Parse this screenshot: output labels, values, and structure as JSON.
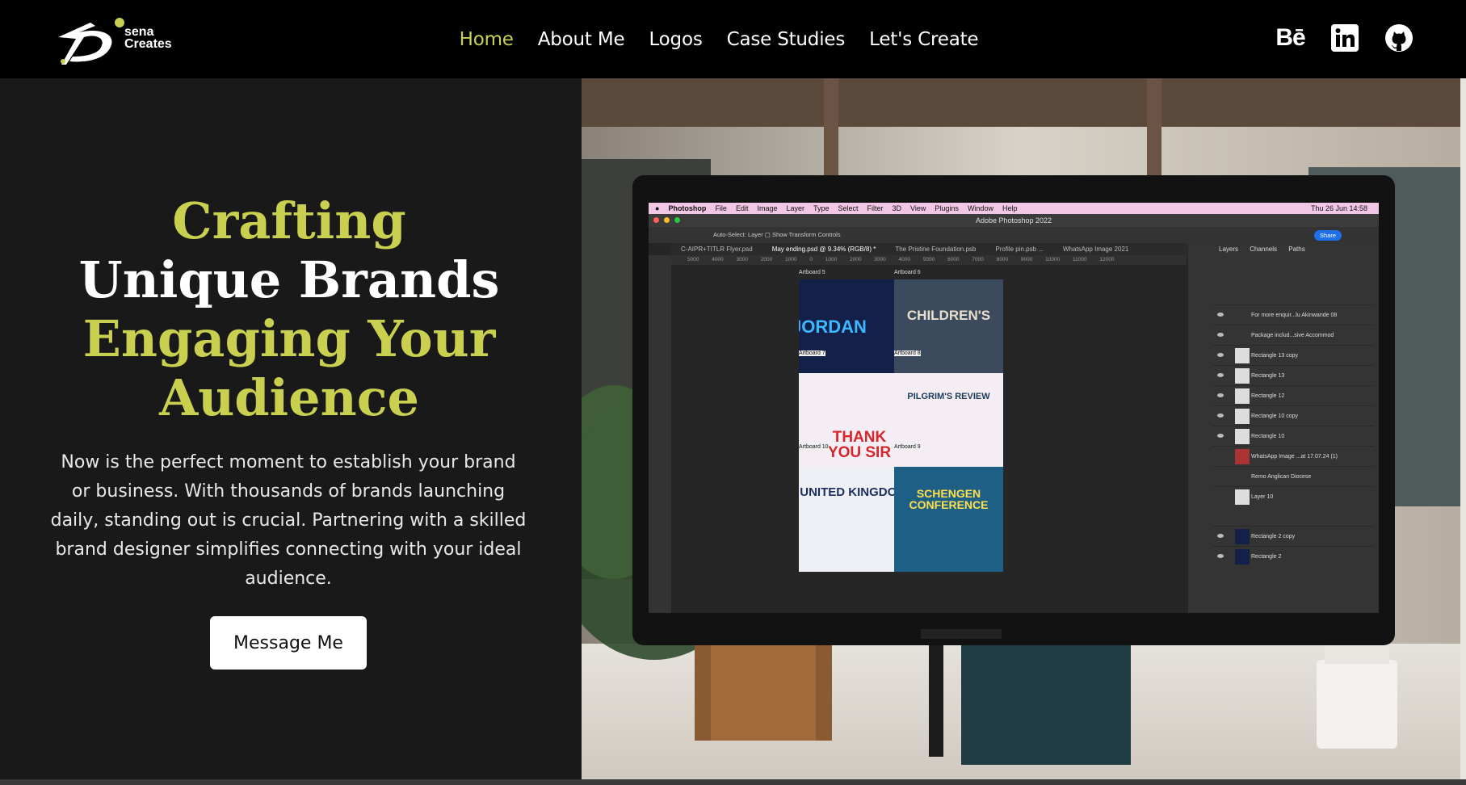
{
  "brand": {
    "logo_text_line1": "sena",
    "logo_text_line2": "Creates"
  },
  "nav": {
    "items": [
      {
        "label": "Home",
        "active": true
      },
      {
        "label": "About Me",
        "active": false
      },
      {
        "label": "Logos",
        "active": false
      },
      {
        "label": "Case Studies",
        "active": false
      },
      {
        "label": "Let's Create",
        "active": false
      }
    ]
  },
  "social": {
    "behance_label": "Bē"
  },
  "hero": {
    "line1": "Crafting",
    "line2": "Unique Brands",
    "line3": "Engaging Your",
    "line4": "Audience",
    "body": "Now is the perfect moment to establish your brand or business. With thousands of brands launching daily, standing out is crucial. Partnering with a skilled brand designer simplifies connecting with your ideal audience.",
    "cta_label": "Message Me"
  },
  "colors": {
    "accent": "#c9cf4e",
    "nav_bg": "#000000",
    "hero_bg": "#191919"
  },
  "photo": {
    "menubar": {
      "app": "Photoshop",
      "items": [
        "File",
        "Edit",
        "Image",
        "Layer",
        "Type",
        "Select",
        "Filter",
        "3D",
        "View",
        "Plugins",
        "Window",
        "Help"
      ],
      "clock": "Thu 26 Jun 14:58"
    },
    "window_title": "Adobe Photoshop 2022",
    "options_bar": "Auto-Select:  Layer   ▢ Show Transform Controls",
    "share_label": "Share",
    "doc_tabs": [
      "C-AIPR+TITLR Flyer.psd",
      "May ending.psd @ 9.34% (RGB/8) *",
      "The Pristine Foundation.psb",
      "Profile pin.psb ...",
      "WhatsApp Image 2021"
    ],
    "ruler": "5000 4000 3000 2000 1000 0 1000 2000 3000 4000 5000 6000 7000 8000 9000 10000 11000 12000",
    "panel_tabs": "Layers  Channels  Paths",
    "layers": [
      "For more enquir...lu Akinwande 08",
      "Package includ...sive Accommod",
      "Rectangle 13 copy",
      "Rectangle 13",
      "Rectangle 12",
      "Rectangle 10 copy",
      "Rectangle 10",
      "WhatsApp Image ...at 17.07.24 (1)",
      "Remo  Anglican  Diocese",
      "Layer 10",
      "Rectangle 2 copy",
      "Rectangle 2"
    ],
    "artboards": [
      "Artboard 5",
      "Artboard 6",
      "Artboard 7",
      "Artboard 8",
      "Artboard 10",
      "Artboard 9"
    ],
    "posters": [
      "JORDAN",
      "CHILDREN'S",
      "THANK YOU SIR",
      "PILGRIM'S REVIEW",
      "UNITED KINGDOM",
      "SCHENGEN CONFERENCE"
    ]
  }
}
